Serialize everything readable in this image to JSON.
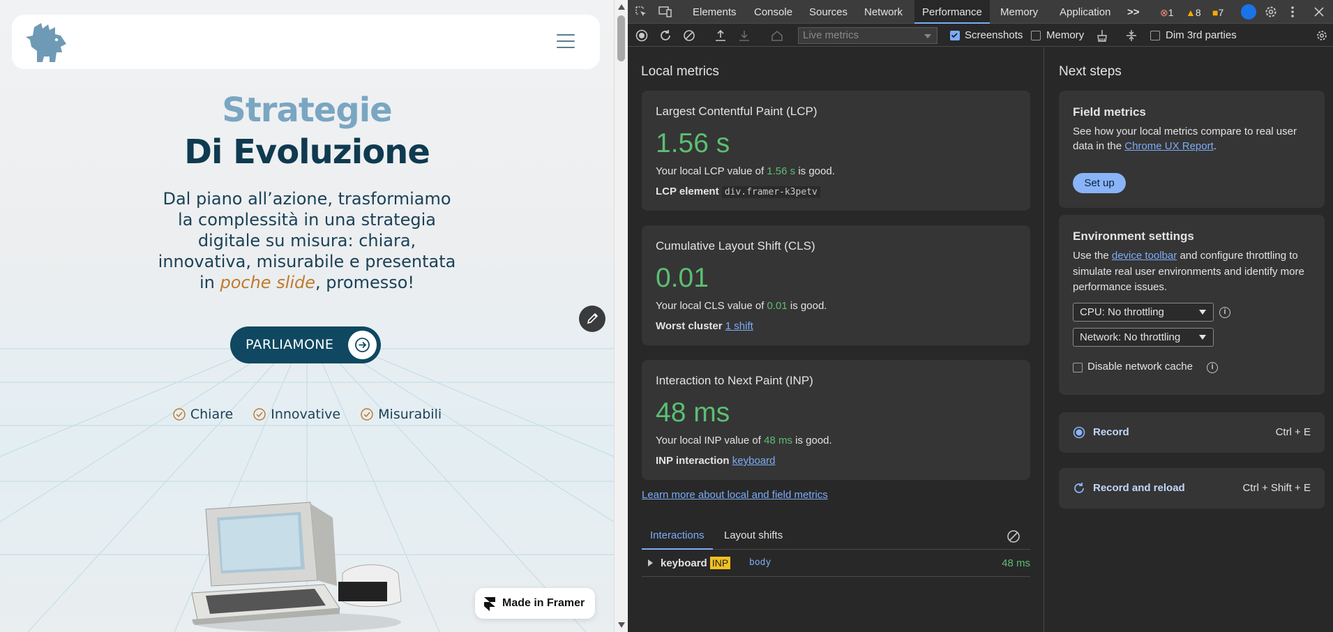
{
  "website": {
    "heading_line1": "Strategie",
    "heading_line2": "Di Evoluzione",
    "lead_part1": "Dal piano all’azione, trasformiamo la complessità in una strategia digitale su misura: chiara, innovativa, misurabile e presentata in ",
    "lead_highlight": "poche slide",
    "lead_part2": ", promesso!",
    "cta_label": "PARLIAMONE",
    "checks": [
      "Chiare",
      "Innovative",
      "Misurabili"
    ],
    "framer_badge": "Made in Framer",
    "accent_color": "#c07a2c",
    "brand_color": "#0f4860"
  },
  "devtools": {
    "tabs": [
      "Elements",
      "Console",
      "Sources",
      "Network",
      "Performance",
      "Memory",
      "Application"
    ],
    "active_tab": "Performance",
    "more_tabs": ">>",
    "errors": "1",
    "warnings": "8",
    "issues": "7",
    "toolbar": {
      "live_metrics_placeholder": "Live metrics",
      "screenshots_label": "Screenshots",
      "screenshots_checked": true,
      "memory_label": "Memory",
      "memory_checked": false,
      "dim_label": "Dim 3rd parties",
      "dim_checked": false
    },
    "local_metrics": {
      "title": "Local metrics",
      "lcp": {
        "title": "Largest Contentful Paint (LCP)",
        "value": "1.56 s",
        "desc_pre": "Your local LCP value of ",
        "desc_val": "1.56 s",
        "desc_post": " is good.",
        "element_label": "LCP element",
        "element_value": "div.framer-k3petv"
      },
      "cls": {
        "title": "Cumulative Layout Shift (CLS)",
        "value": "0.01",
        "desc_pre": "Your local CLS value of ",
        "desc_val": "0.01",
        "desc_post": " is good.",
        "cluster_label": "Worst cluster",
        "cluster_value": "1 shift"
      },
      "inp": {
        "title": "Interaction to Next Paint (INP)",
        "value": "48 ms",
        "desc_pre": "Your local INP value of ",
        "desc_val": "48 ms",
        "desc_post": " is good.",
        "interaction_label": "INP interaction",
        "interaction_value": "keyboard"
      },
      "learn_more": "Learn more about local and field metrics",
      "subtabs": [
        "Interactions",
        "Layout shifts"
      ],
      "rows": [
        {
          "name": "keyboard",
          "badge": "INP",
          "target": "body",
          "time": "48 ms"
        }
      ]
    },
    "next_steps": {
      "title": "Next steps",
      "field": {
        "title": "Field metrics",
        "text_pre": "See how your local metrics compare to real user data in the ",
        "link": "Chrome UX Report",
        "text_post": ".",
        "button": "Set up"
      },
      "env": {
        "title": "Environment settings",
        "text_pre": "Use the ",
        "link": "device toolbar",
        "text_post": " and configure throttling to simulate real user environments and identify more performance issues.",
        "cpu": "CPU: No throttling",
        "network": "Network: No throttling",
        "cache_label": "Disable network cache"
      },
      "record": {
        "label": "Record",
        "shortcut": "Ctrl + E"
      },
      "record_reload": {
        "label": "Record and reload",
        "shortcut": "Ctrl + Shift + E"
      }
    }
  }
}
